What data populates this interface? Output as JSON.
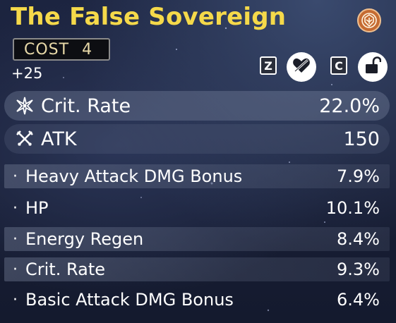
{
  "echo": {
    "name": "The False Sovereign",
    "cost_label": "COST",
    "cost_value": "4",
    "level": "+25",
    "sonata_icon": "sonata-emblem-icon"
  },
  "controls": {
    "key_favorite": "Z",
    "key_lock": "C",
    "favorite_icon": "heart-slash-icon",
    "lock_icon": "unlocked-padlock-icon"
  },
  "main_stats": [
    {
      "label": "Crit. Rate",
      "value": "22.0%",
      "icon": "crit-star-icon"
    },
    {
      "label": "ATK",
      "value": "150",
      "icon": "crossed-swords-icon"
    }
  ],
  "sub_stats": [
    {
      "label": "Heavy Attack DMG Bonus",
      "value": "7.9%"
    },
    {
      "label": "HP",
      "value": "10.1%"
    },
    {
      "label": "Energy Regen",
      "value": "8.4%"
    },
    {
      "label": "Crit. Rate",
      "value": "9.3%"
    },
    {
      "label": "Basic Attack DMG Bonus",
      "value": "6.4%"
    }
  ],
  "bullet": "·"
}
